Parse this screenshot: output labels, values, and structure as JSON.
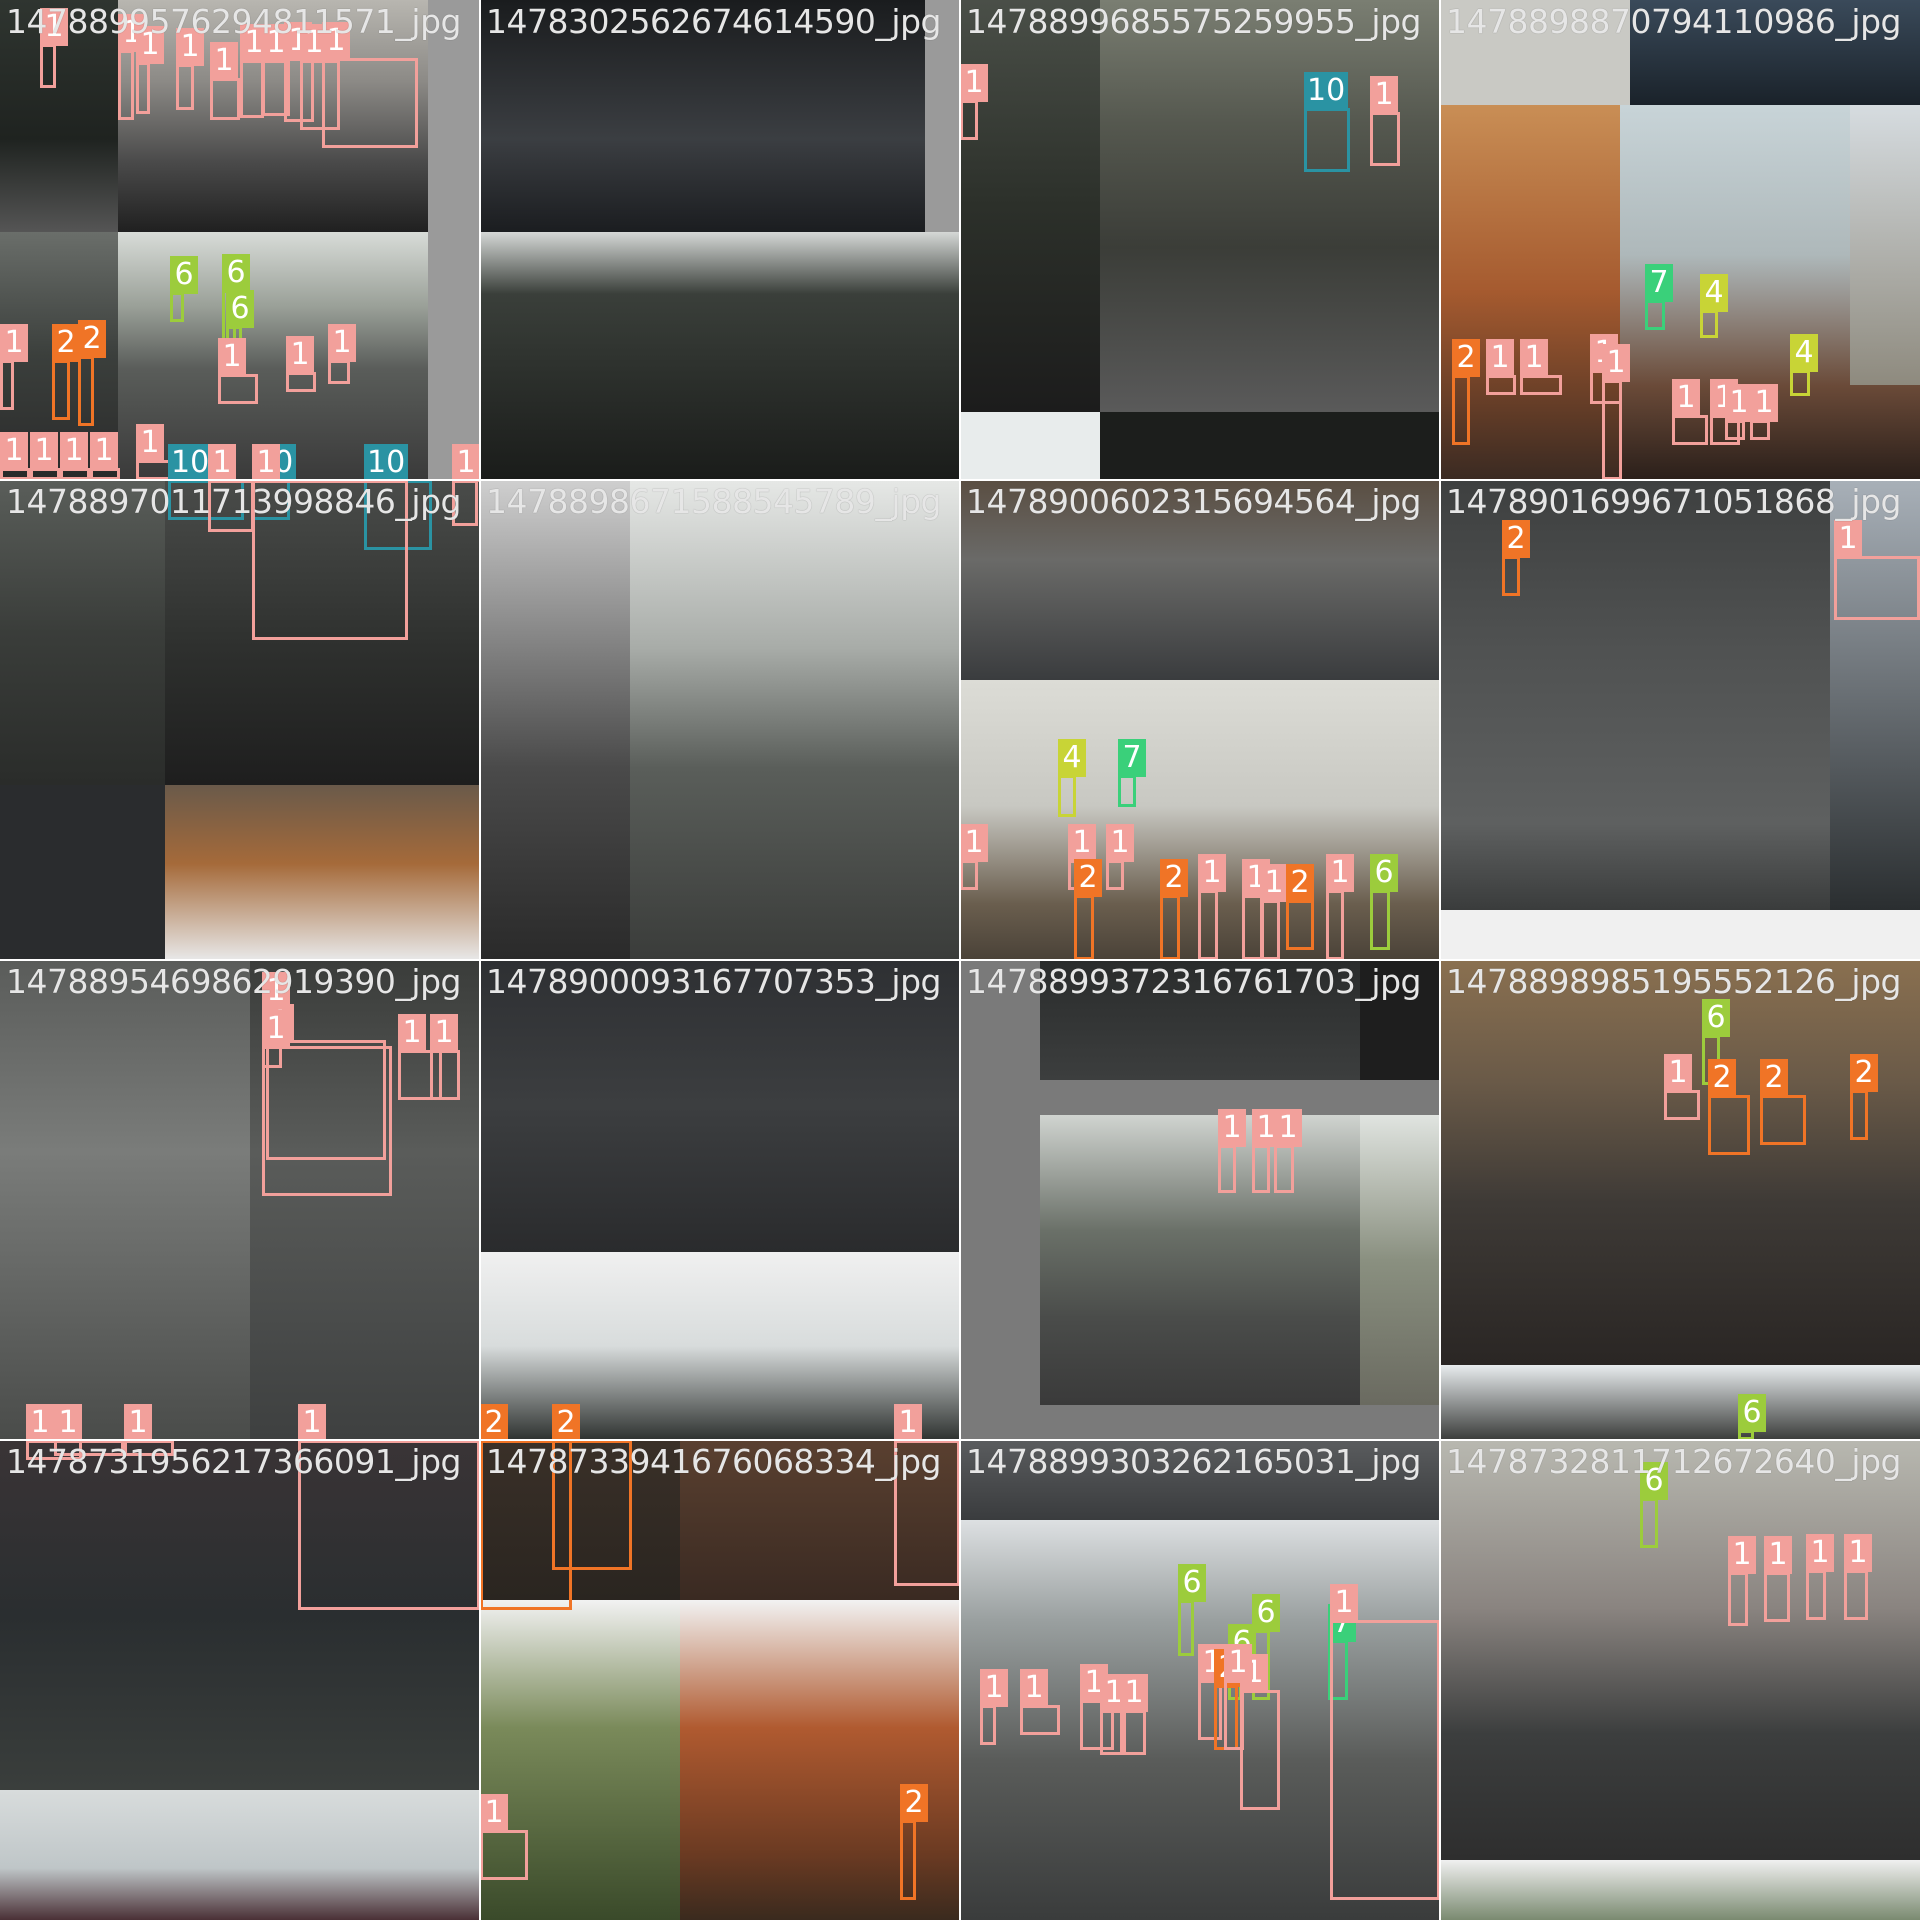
{
  "mosaic": {
    "tiles": [
      {
        "filename": "1478899576294811571_jpg"
      },
      {
        "filename": "1478302562674614590_jpg"
      },
      {
        "filename": "1478899685575259955_jpg"
      },
      {
        "filename": "1478898870794110986_jpg"
      },
      {
        "filename": "1478897011713998846_jpg"
      },
      {
        "filename": "1478898671588545789_jpg"
      },
      {
        "filename": "1478900602315694564_jpg"
      },
      {
        "filename": "1478901699671051868_jpg"
      },
      {
        "filename": "1478895469862919390_jpg"
      },
      {
        "filename": "1478900093167707353_jpg"
      },
      {
        "filename": "1478899372316761703_jpg"
      },
      {
        "filename": "1478898985195552126_jpg"
      },
      {
        "filename": "1478731956217366091_jpg"
      },
      {
        "filename": "1478733941676068334_jpg"
      },
      {
        "filename": "1478899303262165031_jpg"
      },
      {
        "filename": "1478732811712672640_jpg"
      }
    ]
  },
  "class_colors": {
    "1": "#f2a09b",
    "2": "#f07426",
    "4": "#c8d436",
    "6": "#9ccc3c",
    "7": "#3ad07a",
    "10": "#2a93a3"
  },
  "detections": [
    {
      "cls": "1"
    },
    {
      "cls": "1"
    },
    {
      "cls": "1"
    },
    {
      "cls": "1"
    },
    {
      "cls": "1"
    },
    {
      "cls": "1"
    },
    {
      "cls": "1"
    },
    {
      "cls": "1"
    },
    {
      "cls": "1"
    },
    {
      "cls": "1"
    },
    {
      "cls": "6"
    },
    {
      "cls": "6"
    },
    {
      "cls": "6"
    },
    {
      "cls": "1"
    },
    {
      "cls": "1"
    },
    {
      "cls": "1"
    },
    {
      "cls": "2"
    },
    {
      "cls": "2"
    },
    {
      "cls": "1"
    },
    {
      "cls": "1"
    },
    {
      "cls": "1"
    },
    {
      "cls": "1"
    },
    {
      "cls": "1"
    },
    {
      "cls": "1"
    },
    {
      "cls": "1"
    },
    {
      "cls": "10"
    },
    {
      "cls": "1"
    },
    {
      "cls": "7"
    },
    {
      "cls": "4"
    },
    {
      "cls": "4"
    },
    {
      "cls": "2"
    },
    {
      "cls": "1"
    },
    {
      "cls": "1"
    },
    {
      "cls": "1"
    },
    {
      "cls": "1"
    },
    {
      "cls": "1"
    },
    {
      "cls": "1"
    },
    {
      "cls": "1"
    },
    {
      "cls": "1"
    },
    {
      "cls": "10"
    },
    {
      "cls": "10"
    },
    {
      "cls": "10"
    },
    {
      "cls": "1"
    },
    {
      "cls": "1"
    },
    {
      "cls": "1"
    },
    {
      "cls": "4"
    },
    {
      "cls": "7"
    },
    {
      "cls": "1"
    },
    {
      "cls": "1"
    },
    {
      "cls": "1"
    },
    {
      "cls": "2"
    },
    {
      "cls": "2"
    },
    {
      "cls": "1"
    },
    {
      "cls": "1"
    },
    {
      "cls": "1"
    },
    {
      "cls": "2"
    },
    {
      "cls": "1"
    },
    {
      "cls": "6"
    },
    {
      "cls": "2"
    },
    {
      "cls": "1"
    },
    {
      "cls": "1"
    },
    {
      "cls": "1"
    },
    {
      "cls": "1"
    },
    {
      "cls": "1"
    },
    {
      "cls": "1"
    },
    {
      "cls": "1"
    },
    {
      "cls": "1"
    },
    {
      "cls": "1"
    },
    {
      "cls": "1"
    },
    {
      "cls": "2"
    },
    {
      "cls": "2"
    },
    {
      "cls": "1"
    },
    {
      "cls": "1"
    },
    {
      "cls": "1"
    },
    {
      "cls": "1"
    },
    {
      "cls": "6"
    },
    {
      "cls": "1"
    },
    {
      "cls": "2"
    },
    {
      "cls": "2"
    },
    {
      "cls": "2"
    },
    {
      "cls": "6"
    },
    {
      "cls": "1"
    },
    {
      "cls": "1"
    },
    {
      "cls": "2"
    },
    {
      "cls": "6"
    },
    {
      "cls": "6"
    },
    {
      "cls": "6"
    },
    {
      "cls": "7"
    },
    {
      "cls": "1"
    },
    {
      "cls": "1"
    },
    {
      "cls": "1"
    },
    {
      "cls": "1"
    },
    {
      "cls": "1"
    },
    {
      "cls": "1"
    },
    {
      "cls": "2"
    },
    {
      "cls": "1"
    },
    {
      "cls": "1"
    },
    {
      "cls": "1"
    },
    {
      "cls": "6"
    },
    {
      "cls": "1"
    },
    {
      "cls": "1"
    },
    {
      "cls": "1"
    },
    {
      "cls": "1"
    }
  ]
}
